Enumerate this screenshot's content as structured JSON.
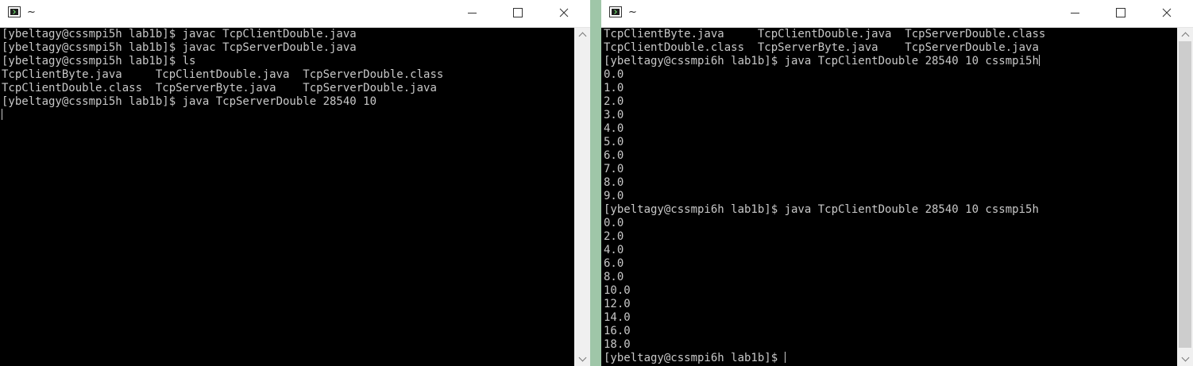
{
  "windows": {
    "left": {
      "title": "~",
      "lines": [
        "[ybeltagy@cssmpi5h lab1b]$ javac TcpClientDouble.java",
        "[ybeltagy@cssmpi5h lab1b]$ javac TcpServerDouble.java",
        "[ybeltagy@cssmpi5h lab1b]$ ls",
        "TcpClientByte.java     TcpClientDouble.java  TcpServerDouble.class",
        "TcpClientDouble.class  TcpServerByte.java    TcpServerDouble.java",
        "[ybeltagy@cssmpi5h lab1b]$ java TcpServerDouble 28540 10"
      ]
    },
    "right": {
      "title": "~",
      "lines": [
        "TcpClientByte.java     TcpClientDouble.java  TcpServerDouble.class",
        "TcpClientDouble.class  TcpServerByte.java    TcpServerDouble.java",
        "[ybeltagy@cssmpi6h lab1b]$ java TcpClientDouble 28540 10 cssmpi5h",
        "0.0",
        "1.0",
        "2.0",
        "3.0",
        "4.0",
        "5.0",
        "6.0",
        "7.0",
        "8.0",
        "9.0",
        "[ybeltagy@cssmpi6h lab1b]$ java TcpClientDouble 28540 10 cssmpi5h",
        "0.0",
        "2.0",
        "4.0",
        "6.0",
        "8.0",
        "10.0",
        "12.0",
        "14.0",
        "16.0",
        "18.0",
        "[ybeltagy@cssmpi6h lab1b]$ "
      ]
    }
  },
  "icons": {
    "app": "terminal-icon",
    "minimize": "minimize-icon",
    "maximize": "maximize-icon",
    "close": "close-icon"
  },
  "colors": {
    "terminal_bg": "#000000",
    "terminal_fg": "#c8c8c8",
    "titlebar_bg": "#ffffff",
    "desktop": "#9fc6a8"
  }
}
